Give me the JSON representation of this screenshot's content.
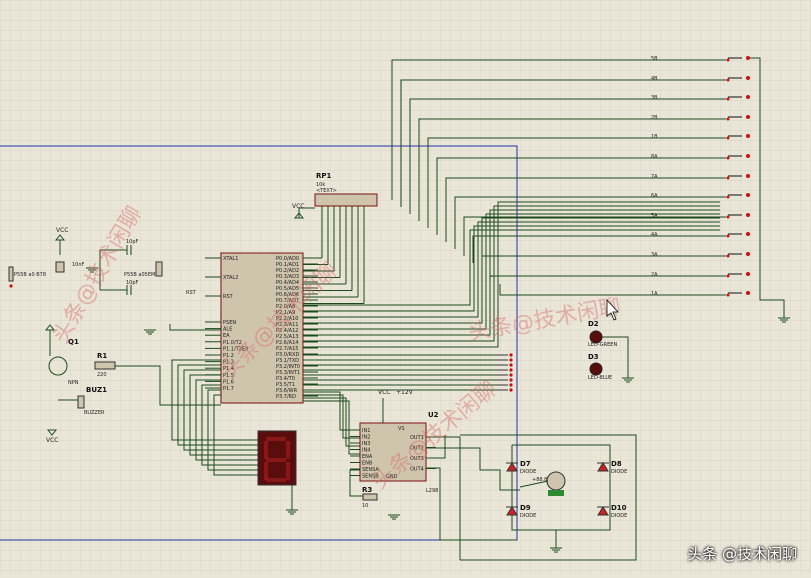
{
  "parts": {
    "rp1": {
      "ref": "RP1",
      "val": "10k"
    },
    "x1": {
      "ref": "X1"
    },
    "u1": {
      "ref": "U1",
      "val": "AT89C52",
      "pins_left": [
        "XTAL1",
        "XTAL2",
        "RST",
        "PSEN",
        "ALE",
        "EA",
        "P1.0/T2",
        "P1.1/T2EX",
        "P1.2",
        "P1.3",
        "P1.4",
        "P1.5",
        "P1.6",
        "P1.7"
      ],
      "pins_right": [
        "P0.0/AD0",
        "P0.1/AD1",
        "P0.2/AD2",
        "P0.3/AD3",
        "P0.4/AD4",
        "P0.5/AD5",
        "P0.6/AD6",
        "P0.7/AD7",
        "P2.0/A8",
        "P2.1/A9",
        "P2.2/A10",
        "P2.3/A11",
        "P2.4/A12",
        "P2.5/A13",
        "P2.6/A14",
        "P2.7/A15",
        "P3.0/RXD",
        "P3.1/TXD",
        "P3.2/INT0",
        "P3.3/INT1",
        "P3.4/T0",
        "P3.5/T1",
        "P3.6/WR",
        "P3.7/RD"
      ]
    },
    "u2": {
      "ref": "U2",
      "val": "L298",
      "pins_left": [
        "IN1",
        "IN2",
        "IN3",
        "IN4",
        "ENA",
        "ENB",
        "SENSA",
        "SENSB"
      ],
      "pins_right": [
        "OUT1",
        "OUT2",
        "OUT3",
        "OUT4"
      ],
      "gnd": "GND",
      "vs": "VS"
    },
    "q1": {
      "ref": "Q1",
      "val": "NPN"
    },
    "r1": {
      "ref": "R1",
      "val": "220"
    },
    "r3": {
      "ref": "R3",
      "val": "10"
    },
    "buz1": {
      "ref": "BUZ1",
      "val": "BUZZER"
    },
    "c1": {
      "val": "10nF"
    },
    "c2": {
      "val": "10pF"
    },
    "c3": {
      "val": "10pF"
    },
    "d2": {
      "ref": "D2",
      "val": "LED-GREEN"
    },
    "d3": {
      "ref": "D3",
      "val": "LED-BLUE"
    },
    "d7": {
      "ref": "D7",
      "val": "DIODE"
    },
    "d8": {
      "ref": "D8",
      "val": "DIODE"
    },
    "d9": {
      "ref": "D9",
      "val": "DIODE"
    },
    "d10": {
      "ref": "D10",
      "val": "DIODE"
    },
    "motor": {
      "val": "+88.8"
    },
    "text_placeholder": "<TEXT>"
  },
  "power": {
    "vcc": "VCC",
    "vs": "+12V"
  },
  "signals": {
    "rst": "RST"
  },
  "watermarks": {
    "left1": "头条@技术闲聊",
    "mid": "头条@技术闲聊",
    "low": "头条@技术闲聊",
    "u2": "头条@技术闲聊",
    "p5558a": "P55B a0 B78",
    "p5558b": "P55B a05EM"
  },
  "switches": [
    "5B",
    "4B",
    "3B",
    "2B",
    "1B",
    "8A",
    "7A",
    "6A",
    "5A",
    "4A",
    "3A",
    "2A",
    "1A"
  ],
  "corner_text": "头条 @技术闲聊",
  "colors": {
    "background": "#e9e5d7",
    "grid": "#d4cfbe",
    "wire": "#1c4a1c",
    "chip_fill": "#cfc5ad",
    "chip_border": "#7a0f0f",
    "frame": "#2233aa",
    "seg_fill": "#5a0d0d",
    "seg_on": "#b02020",
    "pin_red": "#cc1111"
  }
}
